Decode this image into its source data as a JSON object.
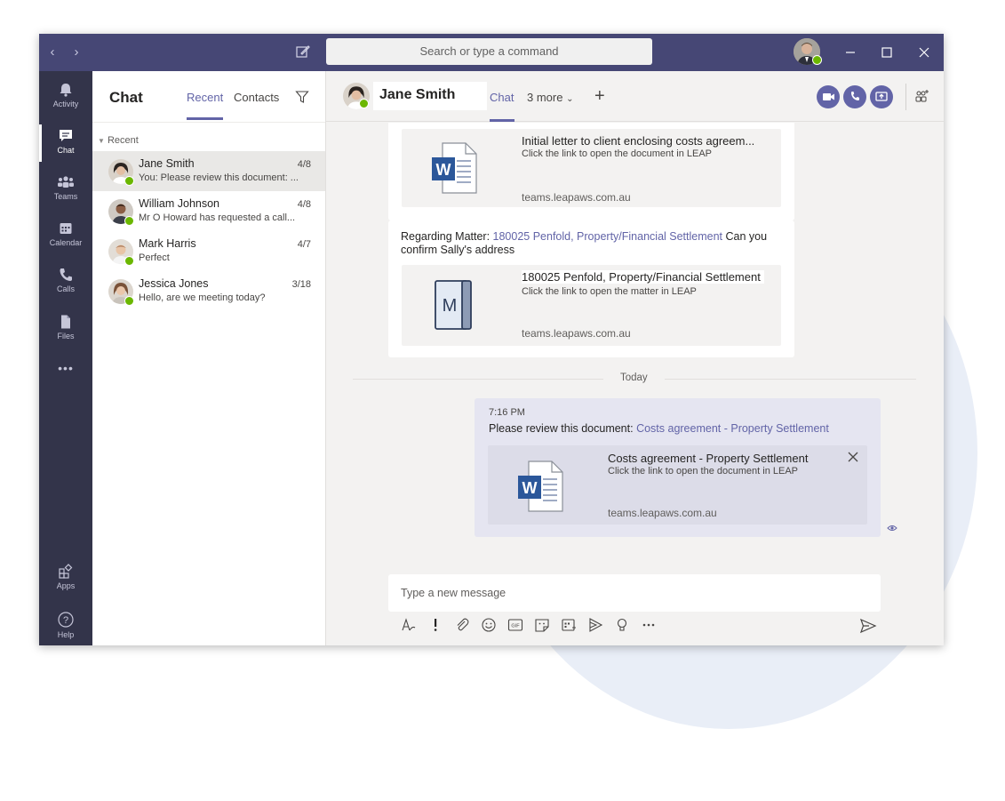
{
  "titlebar": {
    "search_placeholder": "Search or type a command",
    "back_icon": "chevron-left",
    "forward_icon": "chevron-right"
  },
  "rail": {
    "items": [
      {
        "label": "Activity",
        "icon": "bell-icon"
      },
      {
        "label": "Chat",
        "icon": "chat-icon"
      },
      {
        "label": "Teams",
        "icon": "teams-icon"
      },
      {
        "label": "Calendar",
        "icon": "calendar-icon"
      },
      {
        "label": "Calls",
        "icon": "phone-icon"
      },
      {
        "label": "Files",
        "icon": "file-icon"
      },
      {
        "label": "•••",
        "icon": "more-icon"
      }
    ],
    "apps_label": "Apps",
    "help_label": "Help"
  },
  "panel": {
    "title": "Chat",
    "tab_recent": "Recent",
    "tab_contacts": "Contacts",
    "section": "Recent",
    "conversations": [
      {
        "name": "Jane Smith",
        "date": "4/8",
        "preview": "You: Please review this document: ...",
        "selected": true
      },
      {
        "name": "William Johnson",
        "date": "4/8",
        "preview": "Mr O Howard has requested a call..."
      },
      {
        "name": "Mark Harris",
        "date": "4/7",
        "preview": "Perfect"
      },
      {
        "name": "Jessica Jones",
        "date": "3/18",
        "preview": "Hello, are we meeting today?"
      }
    ]
  },
  "header": {
    "name": "Jane Smith",
    "tab_chat": "Chat",
    "tab_more": "3 more",
    "plus": "+"
  },
  "messages": {
    "card1": {
      "title": "Initial letter to client enclosing costs agreem...",
      "sub": "Click the link to open the document in LEAP",
      "link": "teams.leapaws.com.au"
    },
    "card2": {
      "text_prefix": "Regarding Matter: ",
      "matter_link": "180025 Penfold, Property/Financial Settlement",
      "text_suffix": " Can you confirm Sally's address",
      "title": "180025 Penfold, Property/Financial Settlement",
      "sub": "Click the link to open the matter in LEAP",
      "link": "teams.leapaws.com.au",
      "icon_letter": "M"
    },
    "divider": "Today",
    "mine": {
      "time": "7:16 PM",
      "text_prefix": "Please review this document: ",
      "doc_link": "Costs agreement - Property Settlement",
      "title": "Costs agreement - Property Settlement",
      "sub": "Click the link to open the document in LEAP",
      "link": "teams.leapaws.com.au"
    }
  },
  "compose": {
    "placeholder": "Type a new message"
  },
  "colors": {
    "accent": "#6264a7",
    "titlebar": "#464775",
    "rail": "#33344a",
    "presence": "#6bb700",
    "word_blue": "#2b579a"
  }
}
